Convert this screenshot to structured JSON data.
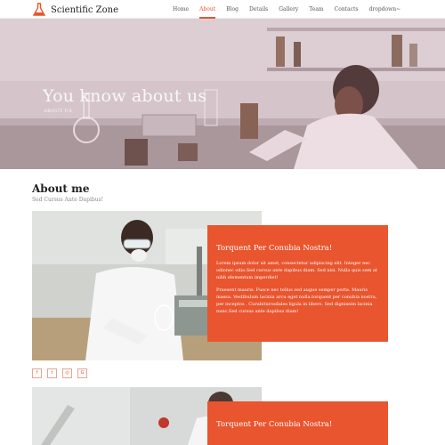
{
  "header": {
    "logo_text": "Scientific Zone",
    "logo_icon": "flask-icon",
    "nav": [
      {
        "label": "Home",
        "active": false
      },
      {
        "label": "About",
        "active": true
      },
      {
        "label": "Blog",
        "active": false
      },
      {
        "label": "Details",
        "active": false
      },
      {
        "label": "Gallery",
        "active": false
      },
      {
        "label": "Team",
        "active": false
      },
      {
        "label": "Contacts",
        "active": false
      },
      {
        "label": "dropdown~",
        "active": false
      }
    ]
  },
  "hero": {
    "title": "You know about us",
    "subtitle": "ABOUT US"
  },
  "about": {
    "title": "About me",
    "subtitle": "Sed Cursus Ante Dapibus!",
    "card1": {
      "title": "Torquent Per Conubia Nostra!",
      "p1": "Lorem ipsum dolor sit amet, consectetur adipiscing elit. Integer nec odionec odio.Sed cursus ante dapibus diam. Sed nisi. Nulla quis sem at nibh elementum imperdiet!",
      "p2": "Praesent mauris. Fusce nec tellus sed augue semper porta. Mauris massa. Vestibulum lacinia arcu eget nulla.torquent per conubia nostra, per inceptos . Curabiturosdales ligula in libero. Sed dignissim lacinia nunc.Sed cursus ante dapibus diam!"
    },
    "socials": [
      {
        "icon": "facebook-icon",
        "glyph": "f"
      },
      {
        "icon": "twitter-icon",
        "glyph": "t"
      },
      {
        "icon": "instagram-icon",
        "glyph": "◎"
      },
      {
        "icon": "google-icon",
        "glyph": "G"
      }
    ],
    "card2": {
      "title": "Torquent Per Conubia Nostra!"
    }
  },
  "colors": {
    "accent": "#e8552e"
  }
}
